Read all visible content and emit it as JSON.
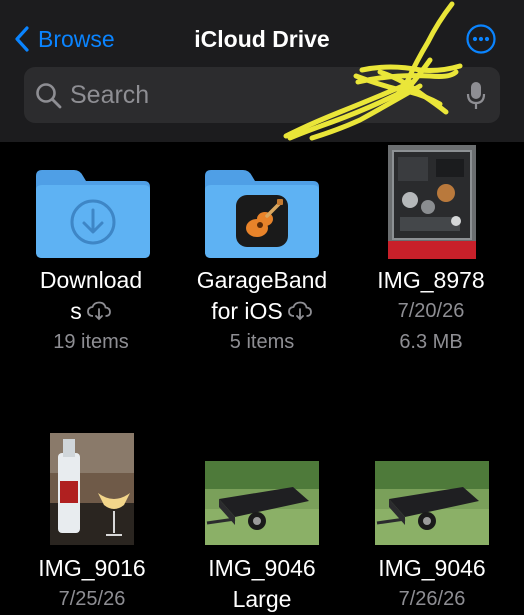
{
  "nav": {
    "back_label": "Browse",
    "title": "iCloud Drive"
  },
  "search": {
    "placeholder": "Search"
  },
  "items": [
    {
      "name_line1": "Download",
      "name_line2": "s",
      "meta": "19 items",
      "kind": "folder",
      "icon": "download-icon"
    },
    {
      "name_line1": "GarageBand",
      "name_line2": "for iOS",
      "meta": "5 items",
      "kind": "folder",
      "icon": "garageband-icon"
    },
    {
      "name_line1": "IMG_8978",
      "date": "7/20/26",
      "size": "6.3 MB",
      "kind": "image"
    },
    {
      "name_line1": "IMG_9016",
      "date": "7/25/26",
      "kind": "image"
    },
    {
      "name_line1": "IMG_9046",
      "name_line2": "Large",
      "kind": "image"
    },
    {
      "name_line1": "IMG_9046",
      "date": "7/26/26",
      "kind": "image"
    }
  ],
  "colors": {
    "accent": "#0a84ff",
    "folder": "#5aaef0",
    "annotation": "#f5f03a"
  }
}
